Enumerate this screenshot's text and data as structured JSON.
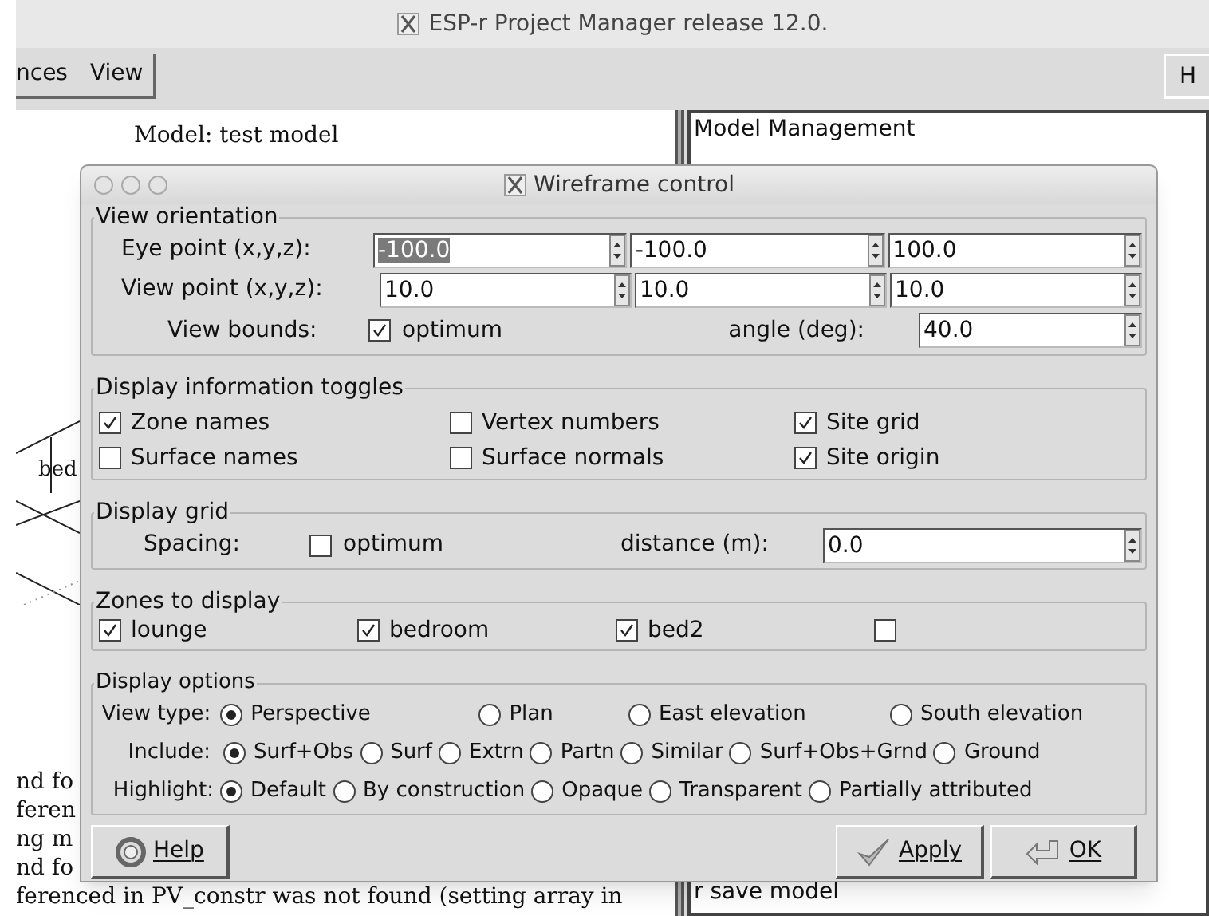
{
  "main_window": {
    "title": "ESP-r Project Manager release 12.0.",
    "menus": [
      "nces",
      "View"
    ],
    "right_menu": "H"
  },
  "model_pane": {
    "title": "Model: test model",
    "drawing_label": "bed"
  },
  "log_lines": [
    "nd fo",
    "feren",
    "ng m",
    "nd fo",
    "ferenced in PV_constr was not found (setting array in"
  ],
  "right_pane": {
    "heading": "Model Management",
    "footer": "r save model"
  },
  "dialog": {
    "title": "Wireframe control",
    "view_orientation": {
      "title": "View orientation",
      "eye_point": {
        "label": "Eye point (x,y,z):",
        "fields": [
          {
            "value": "-100.0",
            "selected": true
          },
          {
            "value": "-100.0",
            "selected": false
          },
          {
            "value": "100.0",
            "selected": false
          }
        ]
      },
      "view_point": {
        "label": "View point (x,y,z):",
        "fields": [
          {
            "value": "10.0",
            "selected": false
          },
          {
            "value": "10.0",
            "selected": false
          },
          {
            "value": "10.0",
            "selected": false
          }
        ]
      },
      "view_bounds": {
        "label": "View bounds:",
        "optimum": {
          "label": "optimum",
          "checked": true
        },
        "angle_label": "angle (deg):",
        "angle": "40.0"
      }
    },
    "toggles": {
      "title": "Display information toggles",
      "items": [
        {
          "label": "Zone names",
          "checked": true
        },
        {
          "label": "Vertex numbers",
          "checked": false
        },
        {
          "label": "Site grid",
          "checked": true
        },
        {
          "label": "Surface names",
          "checked": false
        },
        {
          "label": "Surface normals",
          "checked": false
        },
        {
          "label": "Site origin",
          "checked": true
        }
      ]
    },
    "grid": {
      "title": "Display grid",
      "spacing_label": "Spacing:",
      "optimum": {
        "label": "optimum",
        "checked": false
      },
      "distance_label": "distance (m):",
      "distance": "0.0"
    },
    "zones": {
      "title": "Zones to display",
      "items": [
        {
          "label": "lounge",
          "checked": true
        },
        {
          "label": "bedroom",
          "checked": true
        },
        {
          "label": "bed2",
          "checked": true
        },
        {
          "checked": false
        }
      ]
    },
    "options": {
      "title": "Display options",
      "rows": [
        {
          "label": "View type:",
          "options": [
            {
              "label": "Perspective",
              "selected": true
            },
            {
              "label": "Plan",
              "selected": false
            },
            {
              "label": "East elevation",
              "selected": false
            },
            {
              "label": "South elevation",
              "selected": false
            }
          ]
        },
        {
          "label": "Include:",
          "options": [
            {
              "label": "Surf+Obs",
              "selected": true
            },
            {
              "label": "Surf",
              "selected": false
            },
            {
              "label": "Extrn",
              "selected": false
            },
            {
              "label": "Partn",
              "selected": false
            },
            {
              "label": "Similar",
              "selected": false
            },
            {
              "label": "Surf+Obs+Grnd",
              "selected": false
            },
            {
              "label": "Ground",
              "selected": false
            }
          ]
        },
        {
          "label": "Highlight:",
          "options": [
            {
              "label": "Default",
              "selected": true
            },
            {
              "label": "By construction",
              "selected": false
            },
            {
              "label": "Opaque",
              "selected": false
            },
            {
              "label": "Transparent",
              "selected": false
            },
            {
              "label": "Partially attributed",
              "selected": false
            }
          ]
        }
      ]
    },
    "buttons": {
      "help": "Help",
      "apply": "Apply",
      "ok": "OK"
    }
  }
}
